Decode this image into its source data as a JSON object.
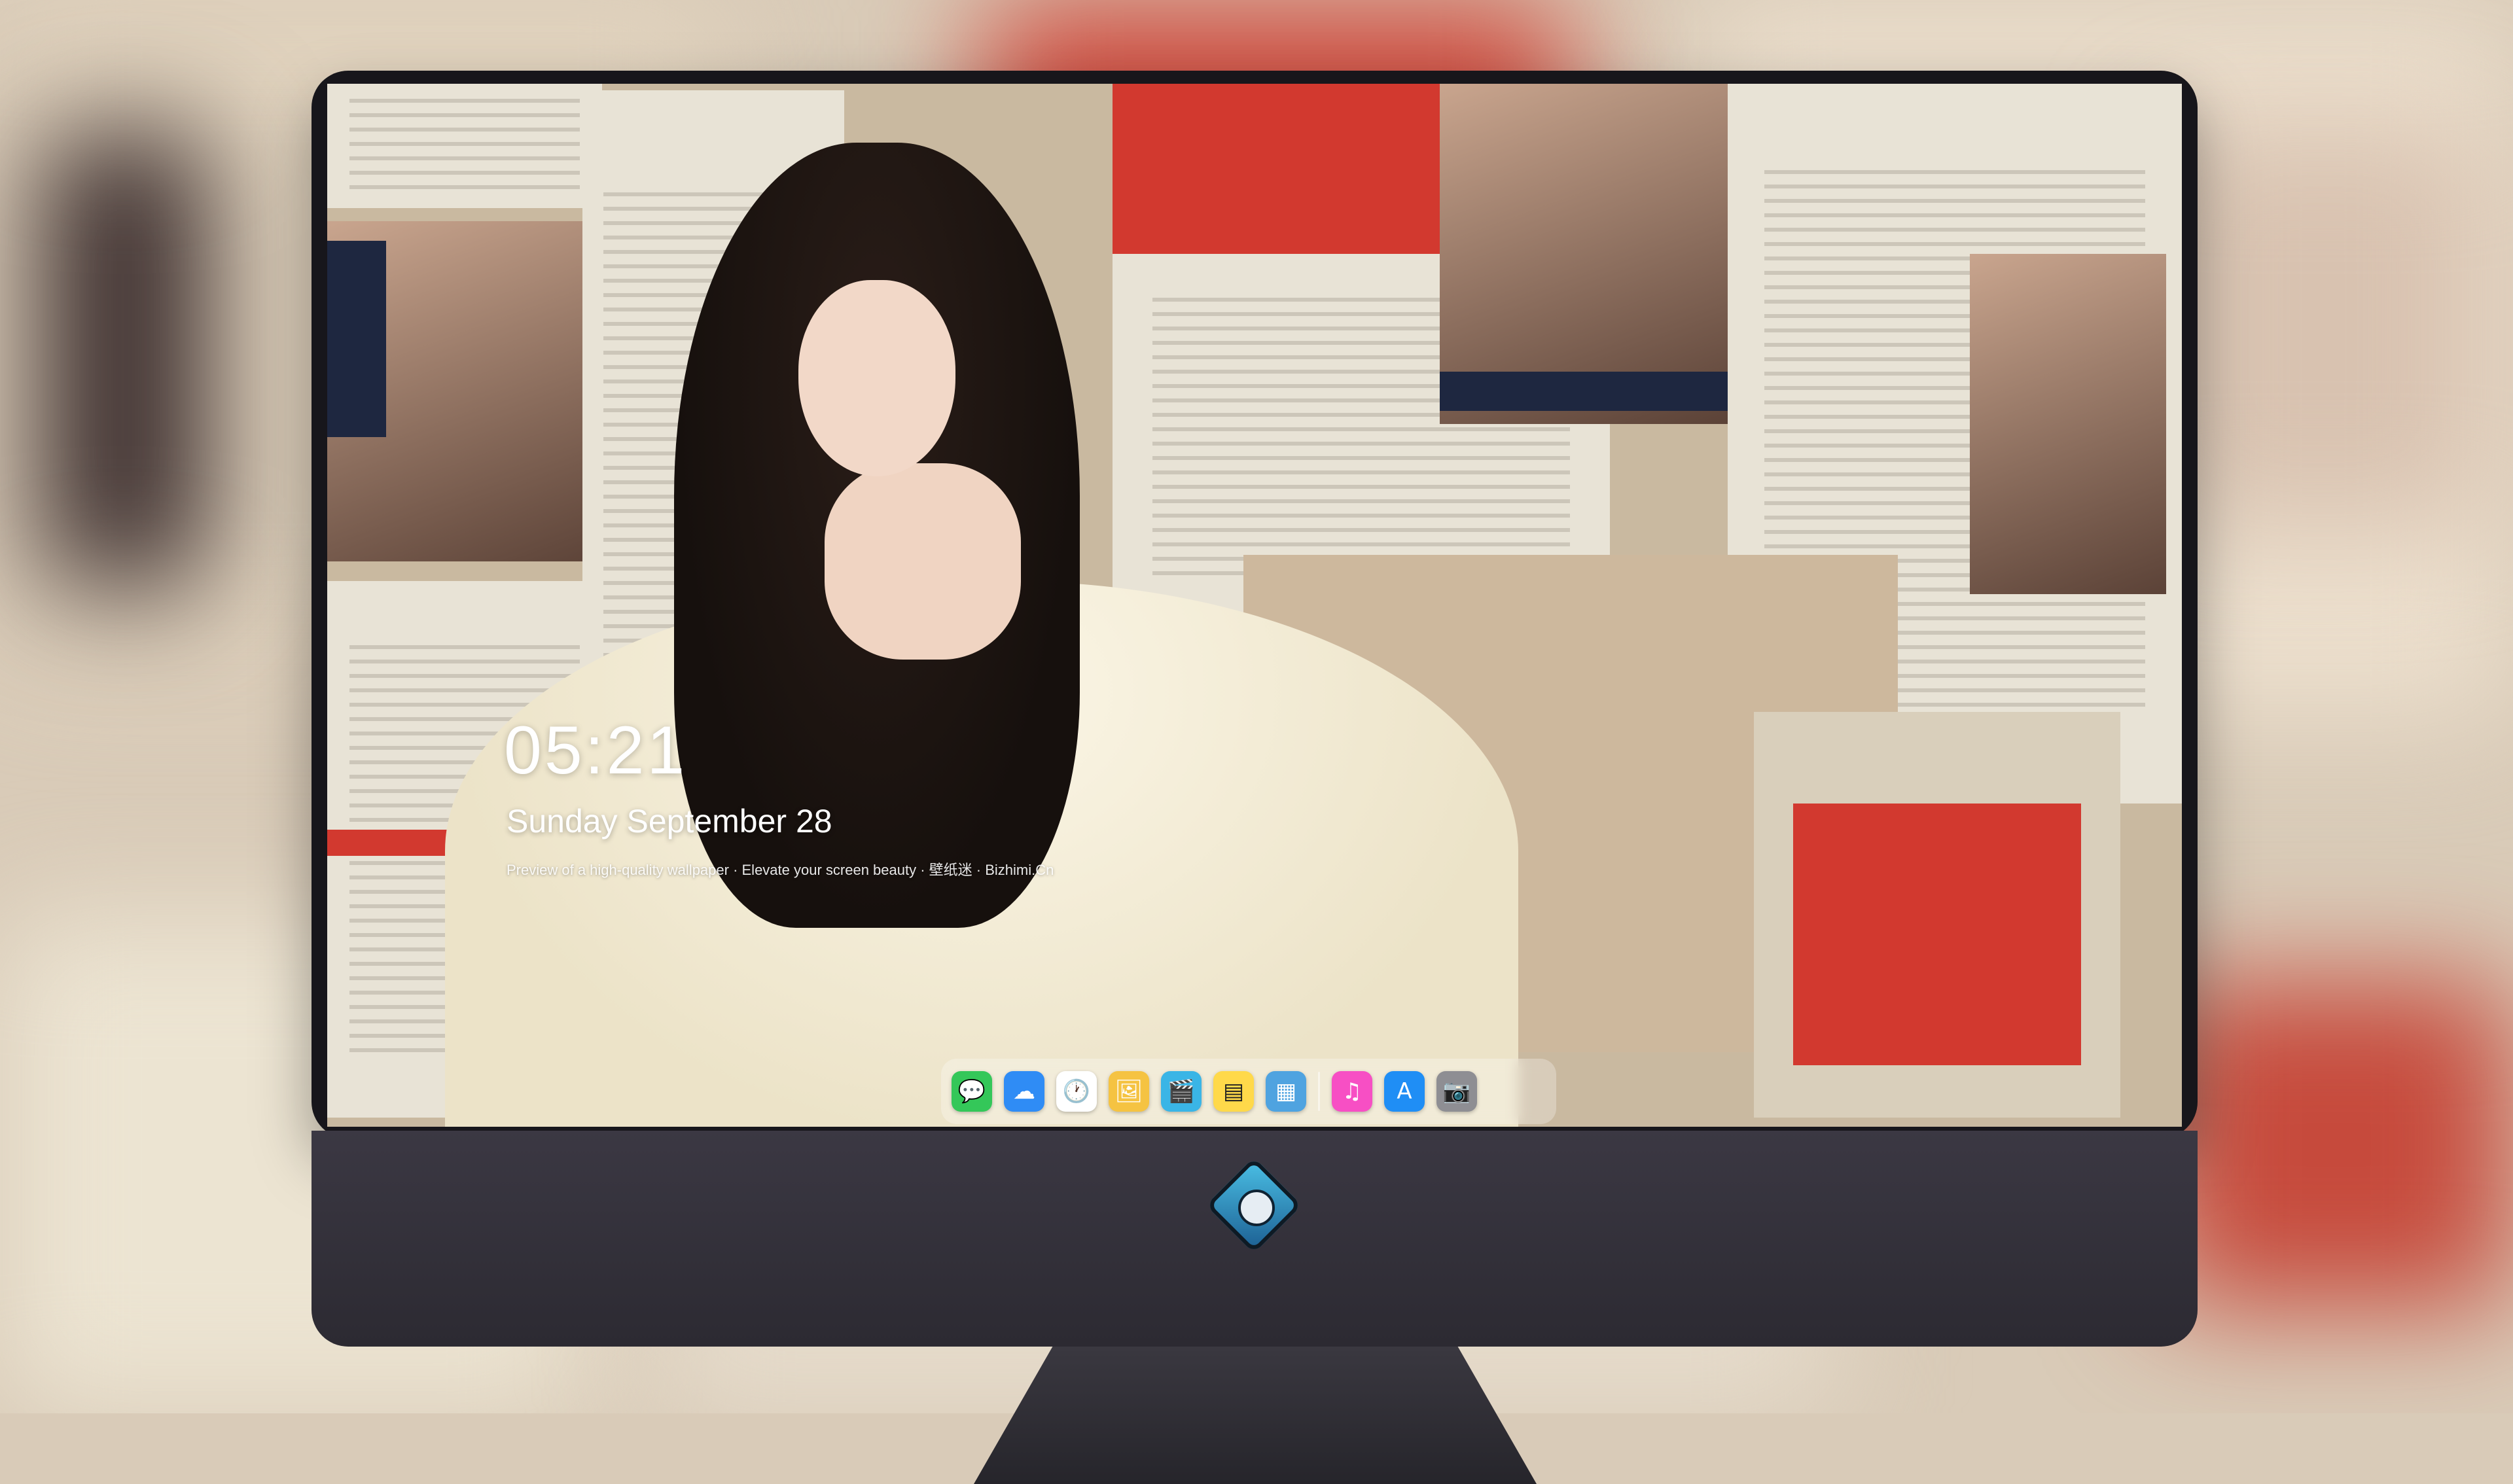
{
  "lock_screen": {
    "time": "05:21",
    "date": "Sunday September 28",
    "tagline": "Preview of a high-quality wallpaper · Elevate your screen beauty · 壁纸迷 · Bizhimi.Cn"
  },
  "dock": {
    "apps": [
      {
        "name": "Messages",
        "icon": "messages-icon",
        "glyph": "💬",
        "color": "#34c759"
      },
      {
        "name": "Weather",
        "icon": "weather-icon",
        "glyph": "☁",
        "color": "#2f8cf5"
      },
      {
        "name": "Clock",
        "icon": "clock-icon",
        "glyph": "🕐",
        "color": "#ffffff"
      },
      {
        "name": "Preview",
        "icon": "preview-icon",
        "glyph": "🖼",
        "color": "#f5c342"
      },
      {
        "name": "Clips",
        "icon": "clips-icon",
        "glyph": "🎬",
        "color": "#3ab5e6"
      },
      {
        "name": "Notes",
        "icon": "notes-icon",
        "glyph": "▤",
        "color": "#ffd94a"
      },
      {
        "name": "Photo Booth",
        "icon": "photo-booth-icon",
        "glyph": "▦",
        "color": "#4fa3e0"
      }
    ],
    "apps_right": [
      {
        "name": "Music",
        "icon": "music-icon",
        "glyph": "♫",
        "color": "#f74fc4"
      },
      {
        "name": "App Store",
        "icon": "app-store-icon",
        "glyph": "A",
        "color": "#1f8ef5"
      },
      {
        "name": "Camera",
        "icon": "camera-icon",
        "glyph": "📷",
        "color": "#8e8e93"
      }
    ]
  },
  "colors": {
    "accent_red": "#d2392f",
    "monitor_body": "#2f2d35"
  }
}
